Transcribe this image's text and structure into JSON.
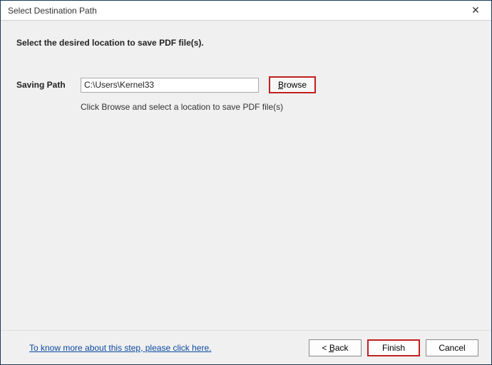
{
  "titlebar": {
    "title": "Select Destination Path",
    "close_glyph": "✕"
  },
  "content": {
    "heading": "Select the desired location to save PDF file(s).",
    "path_label": "Saving Path",
    "path_value": "C:\\Users\\Kernel33",
    "browse_label": "Browse",
    "hint": "Click Browse and select a location to save PDF file(s)"
  },
  "footer": {
    "help_link": "To know more about this step, please click here.",
    "back_label": "< Back",
    "finish_label": "Finish",
    "cancel_label": "Cancel"
  }
}
